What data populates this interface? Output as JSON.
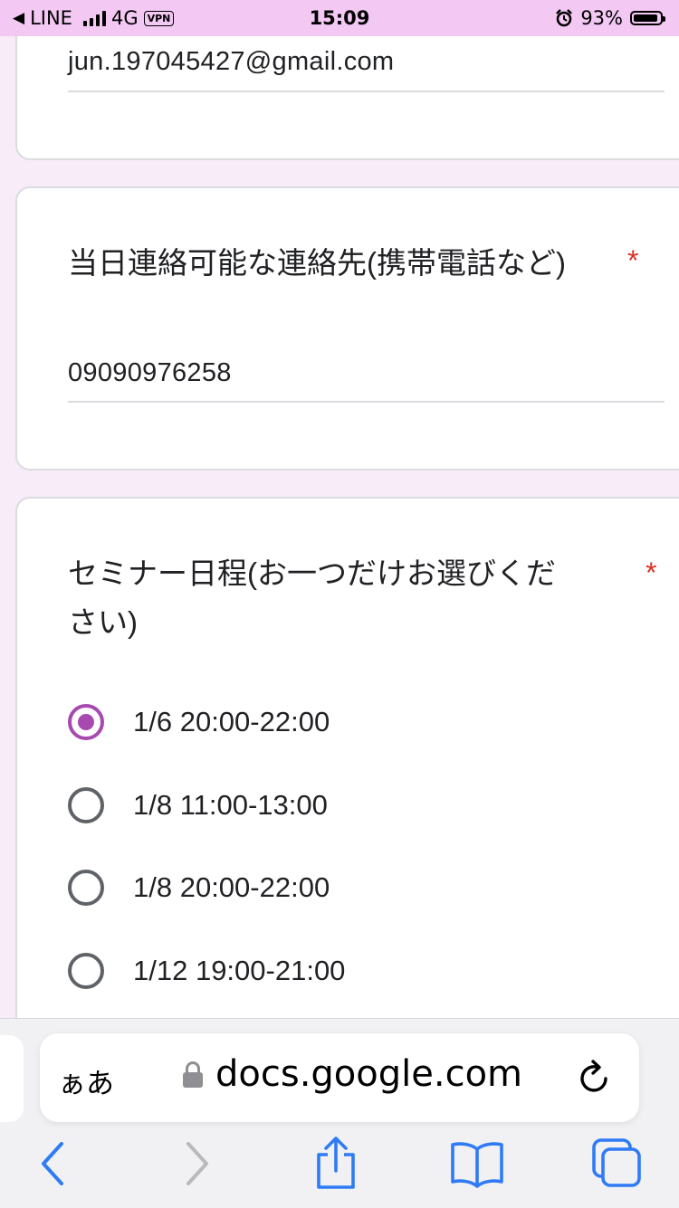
{
  "status_bar": {
    "back_app": "LINE",
    "network": "4G",
    "vpn": "VPN",
    "time": "15:09",
    "battery": "93%",
    "battery_level": 0.93
  },
  "form": {
    "email_value": "jun.197045427@gmail.com",
    "contact_question": "当日連絡可能な連絡先(携帯電話など)",
    "contact_value": "09090976258",
    "required_mark": "*",
    "seminar_question_line1": "セミナー日程(お一つだけお選びくだ",
    "seminar_question_line2": "さい)",
    "options": [
      {
        "label": "1/6 20:00-22:00",
        "selected": true
      },
      {
        "label": "1/8 11:00-13:00",
        "selected": false
      },
      {
        "label": "1/8 20:00-22:00",
        "selected": false
      },
      {
        "label": "1/12 19:00-21:00",
        "selected": false
      }
    ],
    "accent_color": "#a64ab0"
  },
  "browser": {
    "text_size_button": "ぁあ",
    "url": "docs.google.com",
    "icons": [
      "lock-icon",
      "reload-icon",
      "back-icon",
      "forward-icon",
      "share-icon",
      "bookmarks-icon",
      "tabs-icon"
    ]
  }
}
